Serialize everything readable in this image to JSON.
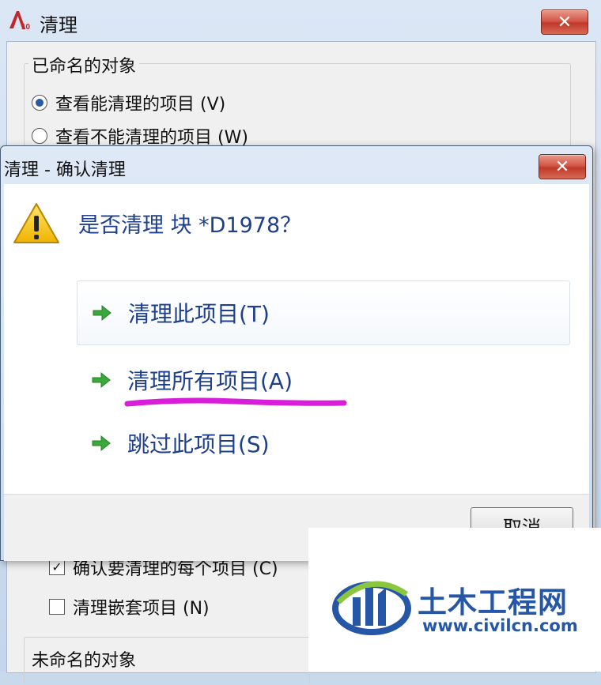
{
  "background_window": {
    "title": "清理",
    "close_label": "✕",
    "named_objects_group": "已命名的对象",
    "radio_purgeable": "查看能清理的项目 (V)",
    "radio_not_purgeable": "查看不能清理的项目 (W)",
    "check_confirm_each": "确认要清理的每个项目 (C)",
    "check_nested": "清理嵌套项目 (N)",
    "unnamed_objects_group": "未命名的对象"
  },
  "dialog": {
    "title": "清理 - 确认清理",
    "close_label": "✕",
    "question": "是否清理 块 *D1978？",
    "commands": [
      {
        "label": "清理此项目(T)"
      },
      {
        "label": "清理所有项目(A)"
      },
      {
        "label": "跳过此项目(S)"
      }
    ],
    "cancel_label": "取消"
  },
  "watermark": {
    "name": "土木工程网",
    "url": "www.civilcn.com"
  },
  "colors": {
    "command_text": "#1e3f8c",
    "highlight_underline": "#d81ed8",
    "arrow_green": "#3aa83a",
    "warning_yellow": "#f5c400"
  }
}
